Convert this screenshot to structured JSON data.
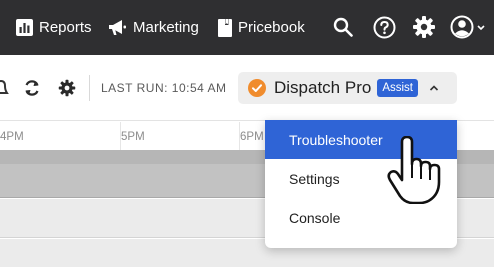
{
  "nav": {
    "items": [
      {
        "label": "Reports",
        "icon": "bar-chart-icon"
      },
      {
        "label": "Marketing",
        "icon": "megaphone-icon"
      },
      {
        "label": "Pricebook",
        "icon": "book-icon"
      }
    ],
    "icons": [
      "search-icon",
      "help-icon",
      "gear-icon",
      "account-icon"
    ]
  },
  "toolbar": {
    "last_run": "LAST RUN: 10:54 AM",
    "dispatch": {
      "name": "Dispatch Pro",
      "badge": "Assist",
      "status_color": "#f08c2d"
    }
  },
  "timeline": {
    "hours": [
      "4PM",
      "5PM",
      "6PM"
    ]
  },
  "menu": {
    "items": [
      {
        "label": "Troubleshooter",
        "active": true
      },
      {
        "label": "Settings",
        "active": false
      },
      {
        "label": "Console",
        "active": false
      }
    ]
  },
  "colors": {
    "topbar": "#2f2f31",
    "accent": "#2f64d6",
    "status": "#f08c2d"
  }
}
